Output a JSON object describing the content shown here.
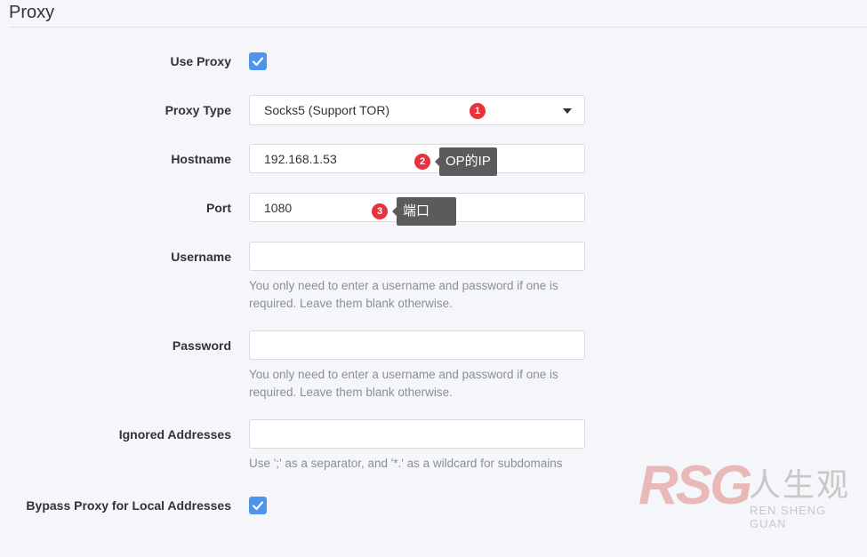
{
  "section": {
    "title": "Proxy"
  },
  "fields": {
    "use_proxy": {
      "label": "Use Proxy",
      "checked": true
    },
    "proxy_type": {
      "label": "Proxy Type",
      "value": "Socks5 (Support TOR)",
      "icon": "caret-down-icon"
    },
    "hostname": {
      "label": "Hostname",
      "value": "192.168.1.53"
    },
    "port": {
      "label": "Port",
      "value": "1080"
    },
    "username": {
      "label": "Username",
      "value": "",
      "help": [
        "You only need to enter a username and password if one is",
        "required. Leave them blank otherwise."
      ]
    },
    "password": {
      "label": "Password",
      "value": "",
      "help": [
        "You only need to enter a username and password if one is",
        "required. Leave them blank otherwise."
      ]
    },
    "ignored_addresses": {
      "label": "Ignored Addresses",
      "value": "",
      "help": [
        "Use ';' as a separator, and '*.' as a wildcard for subdomains"
      ]
    },
    "bypass_local": {
      "label": "Bypass Proxy for Local Addresses",
      "checked": true
    }
  },
  "annotations": [
    {
      "number": "1"
    },
    {
      "number": "2",
      "text": "OP的IP"
    },
    {
      "number": "3",
      "text": "端口"
    }
  ],
  "watermark": {
    "logo": "RSG",
    "chinese": "人生观",
    "pinyin": "REN SHENG GUAN"
  },
  "colors": {
    "accent": "#4f93ea",
    "badge": "#e8323c",
    "tooltip": "#5b5b5b",
    "background": "#f5f6fa"
  }
}
